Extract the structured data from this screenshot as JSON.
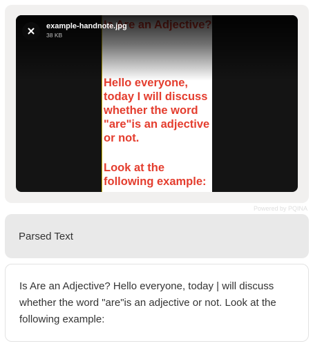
{
  "uploader": {
    "file_name": "example-handnote.jpg",
    "file_size": "38 KB",
    "close_icon": "close-icon",
    "powered_by": "Powered by PQINA"
  },
  "image": {
    "title": "Is Are an Adjective?",
    "body": "Hello everyone,\ntoday I will discuss\nwhether the word\n\"are\"is an adjective\nor not.",
    "example": "Look at the\nfollowing example:"
  },
  "parsed": {
    "heading": "Parsed Text",
    "text": "Is Are an Adjective? Hello everyone, today | will discuss whether the word \"are\"is an adjective or not. Look at the following example:"
  }
}
